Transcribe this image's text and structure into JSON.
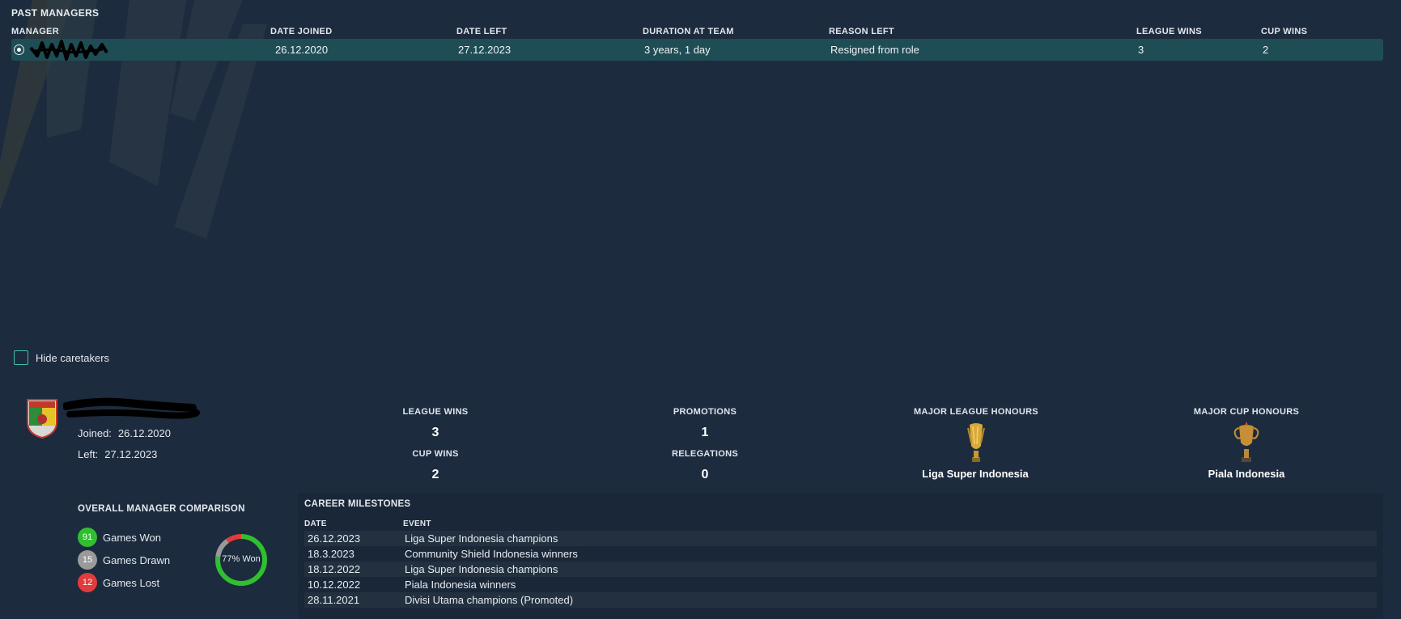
{
  "past_managers": {
    "title": "PAST MANAGERS",
    "columns": {
      "manager": "MANAGER",
      "date_joined": "DATE JOINED",
      "date_left": "DATE LEFT",
      "duration": "DURATION AT TEAM",
      "reason": "REASON LEFT",
      "league_wins": "LEAGUE WINS",
      "cup_wins": "CUP WINS"
    },
    "rows": [
      {
        "date_joined": "26.12.2020",
        "date_left": "27.12.2023",
        "duration": "3 years, 1 day",
        "reason": "Resigned from role",
        "league_wins": "3",
        "cup_wins": "2"
      }
    ]
  },
  "hide_caretakers": {
    "label": "Hide caretakers",
    "checked": false
  },
  "manager_detail": {
    "joined_label": "Joined:",
    "joined": "26.12.2020",
    "left_label": "Left:",
    "left": "27.12.2023",
    "stats": {
      "league_wins_label": "LEAGUE WINS",
      "league_wins": "3",
      "cup_wins_label": "CUP WINS",
      "cup_wins": "2",
      "promotions_label": "PROMOTIONS",
      "promotions": "1",
      "relegations_label": "RELEGATIONS",
      "relegations": "0"
    },
    "honours": {
      "league_label": "MAJOR LEAGUE HONOURS",
      "league_name": "Liga Super Indonesia",
      "cup_label": "MAJOR CUP HONOURS",
      "cup_name": "Piala Indonesia"
    }
  },
  "comparison": {
    "title": "OVERALL MANAGER COMPARISON",
    "won": "91",
    "won_label": "Games Won",
    "drawn": "15",
    "drawn_label": "Games Drawn",
    "lost": "12",
    "lost_label": "Games Lost",
    "donut_label": "77% Won",
    "colors": {
      "won": "#2fbf2f",
      "drawn": "#9a9a9a",
      "lost": "#e23b3b"
    }
  },
  "milestones": {
    "title": "CAREER MILESTONES",
    "date_header": "DATE",
    "event_header": "EVENT",
    "rows": [
      {
        "date": "26.12.2023",
        "event": "Liga Super Indonesia champions"
      },
      {
        "date": "18.3.2023",
        "event": "Community Shield Indonesia winners"
      },
      {
        "date": "18.12.2022",
        "event": "Liga Super Indonesia champions"
      },
      {
        "date": "10.12.2022",
        "event": "Piala Indonesia winners"
      },
      {
        "date": "28.11.2021",
        "event": "Divisi Utama champions (Promoted)"
      }
    ]
  },
  "colors": {
    "background": "#1d2b3e",
    "selected_row": "#1f4d55",
    "accent": "#3fbfb1"
  }
}
